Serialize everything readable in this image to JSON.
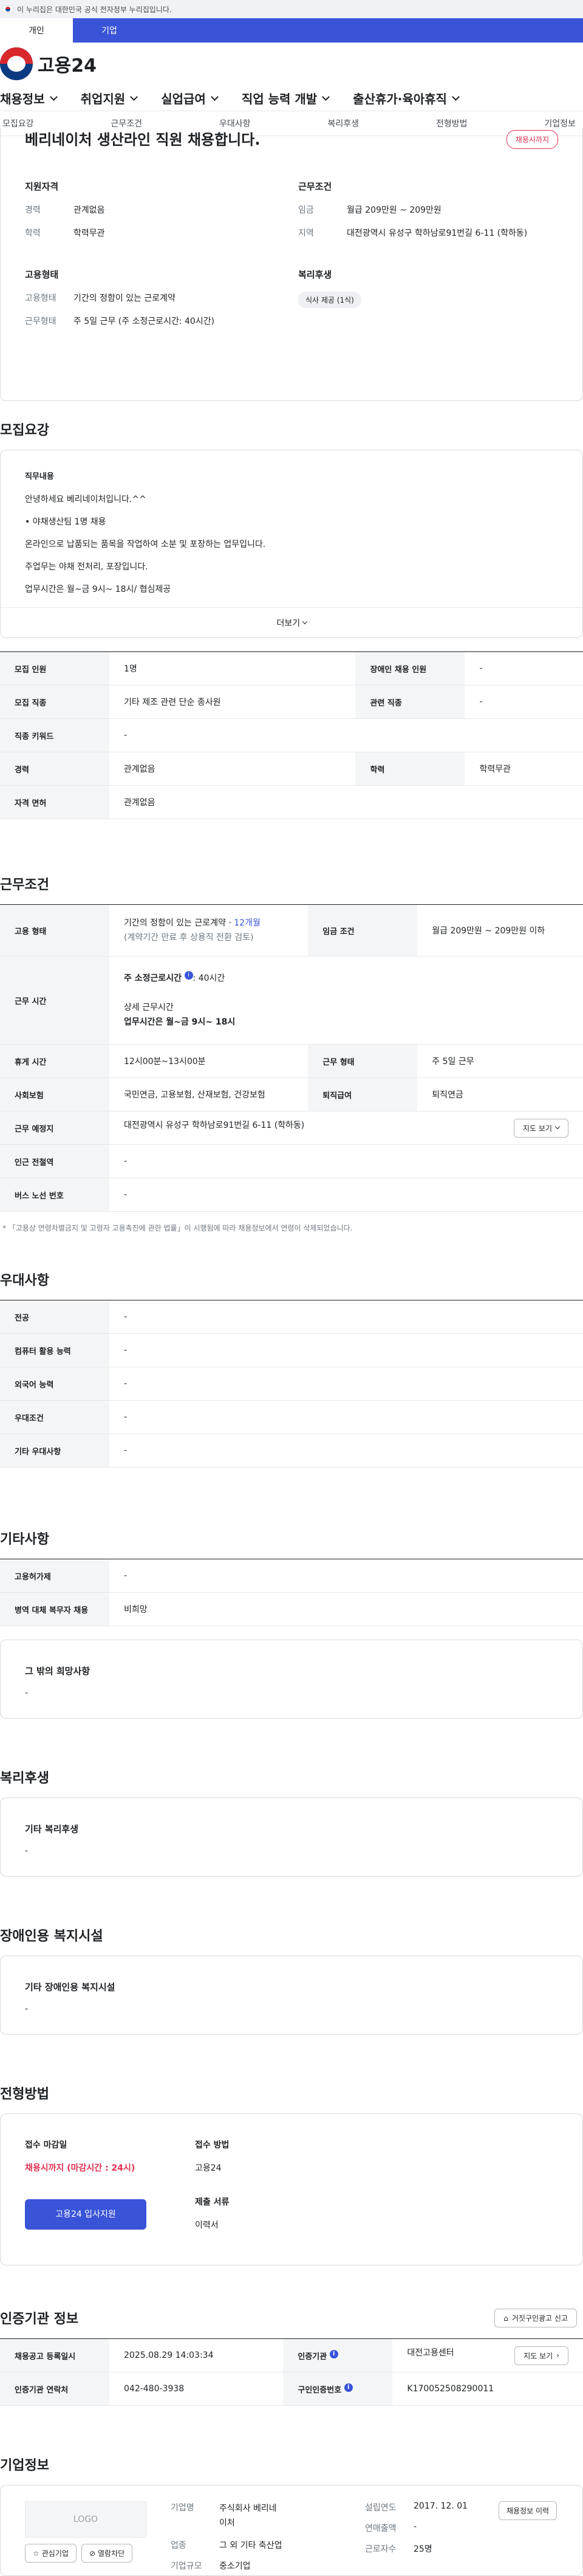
{
  "gov_banner": "이 누리집은 대한민국 공식 전자정부 누리집입니다.",
  "top_tabs": [
    "개인",
    "기업"
  ],
  "logo": "고용24",
  "gnb": [
    "채용정보",
    "취업지원",
    "실업급여",
    "직업 능력 개발",
    "출산휴가·육아휴직"
  ],
  "snb": [
    "모집요강",
    "근무조건",
    "우대사항",
    "복리후생",
    "전형방법",
    "기업정보"
  ],
  "job": {
    "title": "베리네이처 생산라인 직원 채용합니다.",
    "badge": "채용시까지",
    "qual_title": "지원자격",
    "career_k": "경력",
    "career_v": "관계없음",
    "edu_k": "학력",
    "edu_v": "학력무관",
    "emp_title": "고용형태",
    "emptype_k": "고용형태",
    "emptype_v": "기간의 정함이 있는 근로계약",
    "worktype_k": "근무형태",
    "worktype_v": "주 5일 근무 (주 소정근로시간: 40시간)",
    "cond_title": "근무조건",
    "wage_k": "임금",
    "wage_v": "월급 209만원 ~ 209만원",
    "region_k": "지역",
    "region_v": "대전광역시 유성구 학하남로91번길 6-11 (학하동)",
    "welfare_title": "복리후생",
    "welfare_tag": "식사 제공 (1식)"
  },
  "recruit": {
    "title": "모집요강",
    "desc_label": "직무내용",
    "desc_lines": [
      "안녕하세요 베리네이처입니다.^^",
      "• 야채생산팀 1명 채용",
      "온라인으로 납품되는 품목을 작업하여 소분 및 포장하는 업무입니다.",
      "주업무는 야채 전처리, 포장입니다.",
      "업무시간은 월~금 9시~ 18시/ 협심제공"
    ],
    "more": "더보기",
    "rows": [
      [
        "모집 인원",
        "1명",
        "장애인 채용 인원",
        "-"
      ],
      [
        "모집 직종",
        "기타 제조 관련 단순 종사원",
        "관련 직종",
        "-"
      ],
      [
        "직종 키워드",
        "-",
        "",
        ""
      ],
      [
        "경력",
        "관계없음",
        "학력",
        "학력무관"
      ],
      [
        "자격 면허",
        "관계없음",
        "",
        ""
      ]
    ]
  },
  "conditions": {
    "title": "근무조건",
    "emp_k": "고용 형태",
    "emp_v1": "기간의 정함이 있는 근로계약 · ",
    "emp_v1_blue": "12개월",
    "emp_v2": "(계약기간 만료 후 상용직 전환 검토)",
    "wage_k": "임금 조건",
    "wage_v": "월급 209만원 ~ 209만원 이하",
    "hours_k": "근무 시간",
    "hours_v1": "주 소정근로시간",
    "hours_v1b": ": 40시간",
    "hours_v2": "상세 근무시간",
    "hours_v3": "업무시간은 월~금 9시~ 18시",
    "break_k": "휴게 시간",
    "break_v": "12시00분~13시00분",
    "shape_k": "근무 형태",
    "shape_v": "주 5일 근무",
    "ins_k": "사회보험",
    "ins_v": "국민연금, 고용보험, 산재보험, 건강보험",
    "sev_k": "퇴직급여",
    "sev_v": "퇴직연금",
    "place_k": "근무 예정지",
    "place_v": "대전광역시 유성구 학하남로91번길 6-11 (학하동)",
    "map_btn": "지도 보기",
    "subway_k": "인근 전철역",
    "subway_v": "-",
    "bus_k": "버스 노선 번호",
    "bus_v": "-",
    "note": "* 「고용상 연령차별금지 및 고령자 고용촉진에 관한 법률」이 시행됨에 따라 채용정보에서 연령이 삭제되었습니다."
  },
  "prefer": {
    "title": "우대사항",
    "rows": [
      [
        "전공",
        "-"
      ],
      [
        "컴퓨터 활용 능력",
        "-"
      ],
      [
        "외국어 능력",
        "-"
      ],
      [
        "우대조건",
        "-"
      ],
      [
        "기타 우대사항",
        "-"
      ]
    ]
  },
  "etc": {
    "title": "기타사항",
    "rows": [
      [
        "고용허가제",
        "-"
      ],
      [
        "병역 대체 복무자 채용",
        "비희망"
      ]
    ],
    "card_label": "그 밖의 희망사항",
    "card_value": "-"
  },
  "welfare": {
    "title": "복리후생",
    "label": "기타 복리후생",
    "value": "-"
  },
  "disability": {
    "title": "장애인용 복지시설",
    "label": "기타 장애인용 복지시설",
    "value": "-"
  },
  "process": {
    "title": "전형방법",
    "deadline_label": "접수 마감일",
    "deadline_value": "채용시까지 (마감시간 : 24시)",
    "apply_btn": "고용24 입사지원",
    "method_label": "접수 방법",
    "method_value": "고용24",
    "docs_label": "제출 서류",
    "docs_value": "이력서"
  },
  "agency": {
    "title": "인증기관 정보",
    "report_btn": "거짓구인광고 신고",
    "reg_k": "채용공고 등록일시",
    "reg_v": "2025.08.29 14:03:34",
    "org_k": "인증기관",
    "org_v": "대전고용센터",
    "map_btn": "지도 보기",
    "tel_k": "인증기관 연락처",
    "tel_v": "042-480-3938",
    "num_k": "구인인증번호",
    "num_v": "K170052508290011"
  },
  "company": {
    "title": "기업정보",
    "logo": "LOGO",
    "fav_btn": "관심기업",
    "block_btn": "열람차단",
    "name_k": "기업명",
    "name_v1": "주식회사 베리네",
    "name_v2": "이처",
    "ind_k": "업종",
    "ind_v": "그 외 기타 축산업",
    "size_k": "기업규모",
    "size_v": "중소기업",
    "year_k": "설립연도",
    "year_v": "2017. 12. 01",
    "sales_k": "연매출액",
    "sales_v": "-",
    "emp_k": "근로자수",
    "emp_v": "25명",
    "history_btn": "채용정보 이력"
  }
}
